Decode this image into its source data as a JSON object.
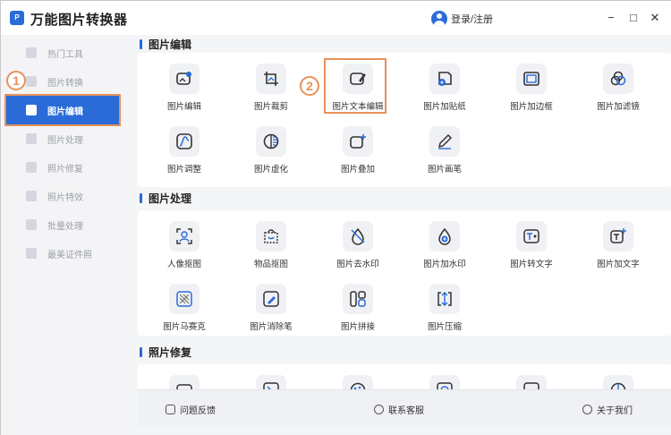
{
  "app": {
    "title": "万能图片转换器",
    "logo_text": "P"
  },
  "header": {
    "login_label": "登录/注册"
  },
  "window_controls": {
    "minimize": "−",
    "maximize": "□",
    "close": "✕"
  },
  "sidebar": {
    "items": [
      {
        "label": "热门工具",
        "icon": "fire-icon"
      },
      {
        "label": "图片转换",
        "icon": "convert-icon"
      },
      {
        "label": "图片编辑",
        "icon": "edit-icon",
        "active": true
      },
      {
        "label": "图片处理",
        "icon": "process-icon"
      },
      {
        "label": "照片修复",
        "icon": "repair-icon"
      },
      {
        "label": "照片特效",
        "icon": "effect-icon"
      },
      {
        "label": "批量处理",
        "icon": "batch-icon"
      },
      {
        "label": "最美证件照",
        "icon": "idphoto-icon"
      }
    ]
  },
  "annotations": {
    "step1": "1",
    "step2": "2"
  },
  "sections": {
    "edit": {
      "title": "图片编辑",
      "tools": [
        "图片编辑",
        "图片裁剪",
        "图片文本编辑",
        "图片加贴纸",
        "图片加边框",
        "图片加滤镜",
        "图片调整",
        "图片虚化",
        "图片叠加",
        "图片画笔"
      ]
    },
    "process": {
      "title": "图片处理",
      "tools": [
        "人像抠图",
        "物品抠图",
        "图片去水印",
        "图片加水印",
        "图片转文字",
        "图片加文字",
        "图片马赛克",
        "图片消除笔",
        "图片拼接",
        "图片压缩"
      ]
    },
    "repair": {
      "title": "照片修复"
    }
  },
  "footer": {
    "feedback": "问题反馈",
    "contact": "联系客服",
    "about": "关于我们"
  },
  "colors": {
    "accent": "#2a6bd8",
    "annotation": "#e8915a"
  }
}
